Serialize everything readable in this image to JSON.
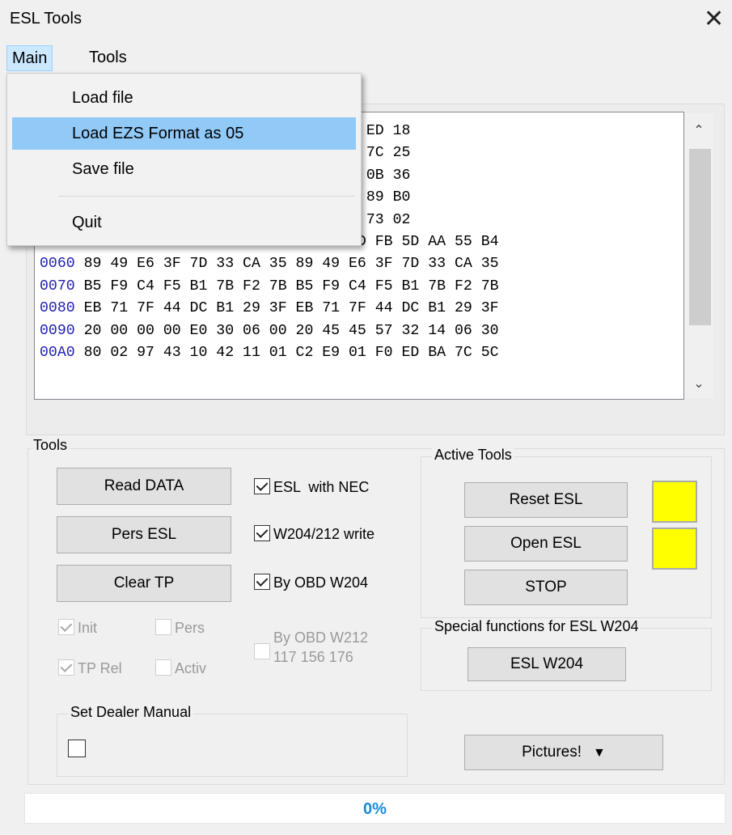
{
  "window": {
    "title": "ESL Tools",
    "close_glyph": "✕"
  },
  "menubar": {
    "items": [
      "Main",
      "Tools"
    ]
  },
  "dropdown": {
    "items": [
      "Load file",
      "Load EZS Format as 05",
      "Save file",
      "Quit"
    ],
    "highlighted": "Load EZS Format as 05"
  },
  "hex": {
    "lines": [
      {
        "addr": "",
        "bytes": "                 3 94 AD BB 04 6C 76 ED 18"
      },
      {
        "addr": "",
        "bytes": "                 6 07 19 E3 7B A7 1E 7C 25"
      },
      {
        "addr": "",
        "bytes": "                 5 94 B8 34 C0 28 B5 0B 36"
      },
      {
        "addr": "",
        "bytes": "                 0 6E 64 FE D7 BD 8E 89 B0"
      },
      {
        "addr": "",
        "bytes": "                 2 59 C2 7A 4A 11 43 73 02"
      },
      {
        "addr": "0050",
        "bytes": " 7E C4 5D FB 5D AA 55 B4 7E C4 5D FB 5D AA 55 B4"
      },
      {
        "addr": "0060",
        "bytes": " 89 49 E6 3F 7D 33 CA 35 89 49 E6 3F 7D 33 CA 35"
      },
      {
        "addr": "0070",
        "bytes": " B5 F9 C4 F5 B1 7B F2 7B B5 F9 C4 F5 B1 7B F2 7B"
      },
      {
        "addr": "0080",
        "bytes": " EB 71 7F 44 DC B1 29 3F EB 71 7F 44 DC B1 29 3F"
      },
      {
        "addr": "0090",
        "bytes": " 20 00 00 00 E0 30 06 00 20 45 45 57 32 14 06 30"
      },
      {
        "addr": "00A0",
        "bytes": " 80 02 97 43 10 42 11 01 C2 E9 01 F0 ED BA 7C 5C"
      }
    ],
    "scroll_up_icon": "chevron-up-icon",
    "scroll_down_icon": "chevron-down-icon"
  },
  "tools": {
    "label": "Tools",
    "read_data": "Read DATA",
    "pers_esl": "Pers ESL",
    "clear_tp": "Clear TP",
    "esl_with_nec": "ESL  with NEC",
    "w204_212_write": "W204/212 write",
    "by_obd_w204": "By OBD W204",
    "init": "Init",
    "pers": "Pers",
    "tp_rel": "TP Rel",
    "activ": "Activ",
    "by_obd_w212": "By OBD W212\n117 156 176"
  },
  "active_tools": {
    "label": "Active Tools",
    "reset_esl": "Reset ESL",
    "open_esl": "Open ESL",
    "stop": "STOP",
    "indicator_color": "#ffff00"
  },
  "special": {
    "label": "Special functions for ESL W204",
    "esl_w204": "ESL W204"
  },
  "dealer": {
    "label": "Set Dealer Manual"
  },
  "pictures": {
    "label": "Pictures!"
  },
  "progress": {
    "text": "0%",
    "value": 0
  }
}
